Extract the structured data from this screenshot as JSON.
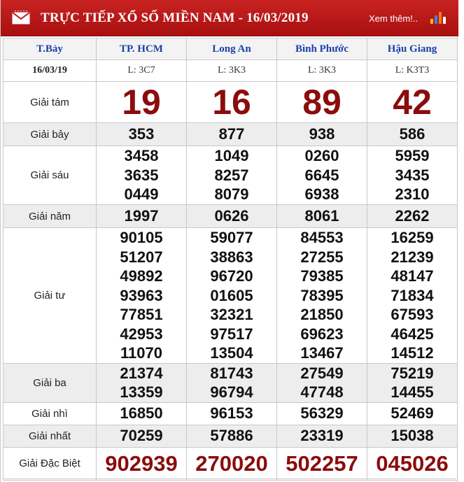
{
  "header": {
    "title": "TRỰC TIẾP XỔ SỐ MIỀN NAM - 16/03/2019",
    "more_link": "Xem thêm!..",
    "mail_icon": "mail-icon",
    "chart_icon": "bar-chart-icon",
    "background_color": "#b81818"
  },
  "table": {
    "day": "T.Bảy",
    "date": "16/03/19",
    "provinces": [
      {
        "name": "TP. HCM",
        "code": "L: 3C7"
      },
      {
        "name": "Long An",
        "code": "L: 3K3"
      },
      {
        "name": "Bình Phước",
        "code": "L: 3K3"
      },
      {
        "name": "Hậu Giang",
        "code": "L: K3T3"
      }
    ],
    "prizes": [
      {
        "label": "Giải tám",
        "values": [
          [
            "19"
          ],
          [
            "16"
          ],
          [
            "89"
          ],
          [
            "42"
          ]
        ]
      },
      {
        "label": "Giải bảy",
        "values": [
          [
            "353"
          ],
          [
            "877"
          ],
          [
            "938"
          ],
          [
            "586"
          ]
        ]
      },
      {
        "label": "Giải sáu",
        "values": [
          [
            "3458",
            "3635",
            "0449"
          ],
          [
            "1049",
            "8257",
            "8079"
          ],
          [
            "0260",
            "6645",
            "6938"
          ],
          [
            "5959",
            "3435",
            "2310"
          ]
        ]
      },
      {
        "label": "Giải năm",
        "values": [
          [
            "1997"
          ],
          [
            "0626"
          ],
          [
            "8061"
          ],
          [
            "2262"
          ]
        ]
      },
      {
        "label": "Giải tư",
        "values": [
          [
            "90105",
            "51207",
            "49892",
            "93963",
            "77851",
            "42953",
            "11070"
          ],
          [
            "59077",
            "38863",
            "96720",
            "01605",
            "32321",
            "97517",
            "13504"
          ],
          [
            "84553",
            "27255",
            "79385",
            "78395",
            "21850",
            "69623",
            "13467"
          ],
          [
            "16259",
            "21239",
            "48147",
            "71834",
            "67593",
            "46425",
            "14512"
          ]
        ]
      },
      {
        "label": "Giải ba",
        "values": [
          [
            "21374",
            "13359"
          ],
          [
            "81743",
            "96794"
          ],
          [
            "27549",
            "47748"
          ],
          [
            "75219",
            "14455"
          ]
        ]
      },
      {
        "label": "Giải nhì",
        "values": [
          [
            "16850"
          ],
          [
            "96153"
          ],
          [
            "56329"
          ],
          [
            "52469"
          ]
        ]
      },
      {
        "label": "Giải nhất",
        "values": [
          [
            "70259"
          ],
          [
            "57886"
          ],
          [
            "23319"
          ],
          [
            "15038"
          ]
        ]
      },
      {
        "label": "Giải Đặc Biệt",
        "values": [
          [
            "902939"
          ],
          [
            "270020"
          ],
          [
            "502257"
          ],
          [
            "045026"
          ]
        ]
      }
    ],
    "highlight_color": "#8b0c0c",
    "header_text_color": "#1a3fa8"
  }
}
